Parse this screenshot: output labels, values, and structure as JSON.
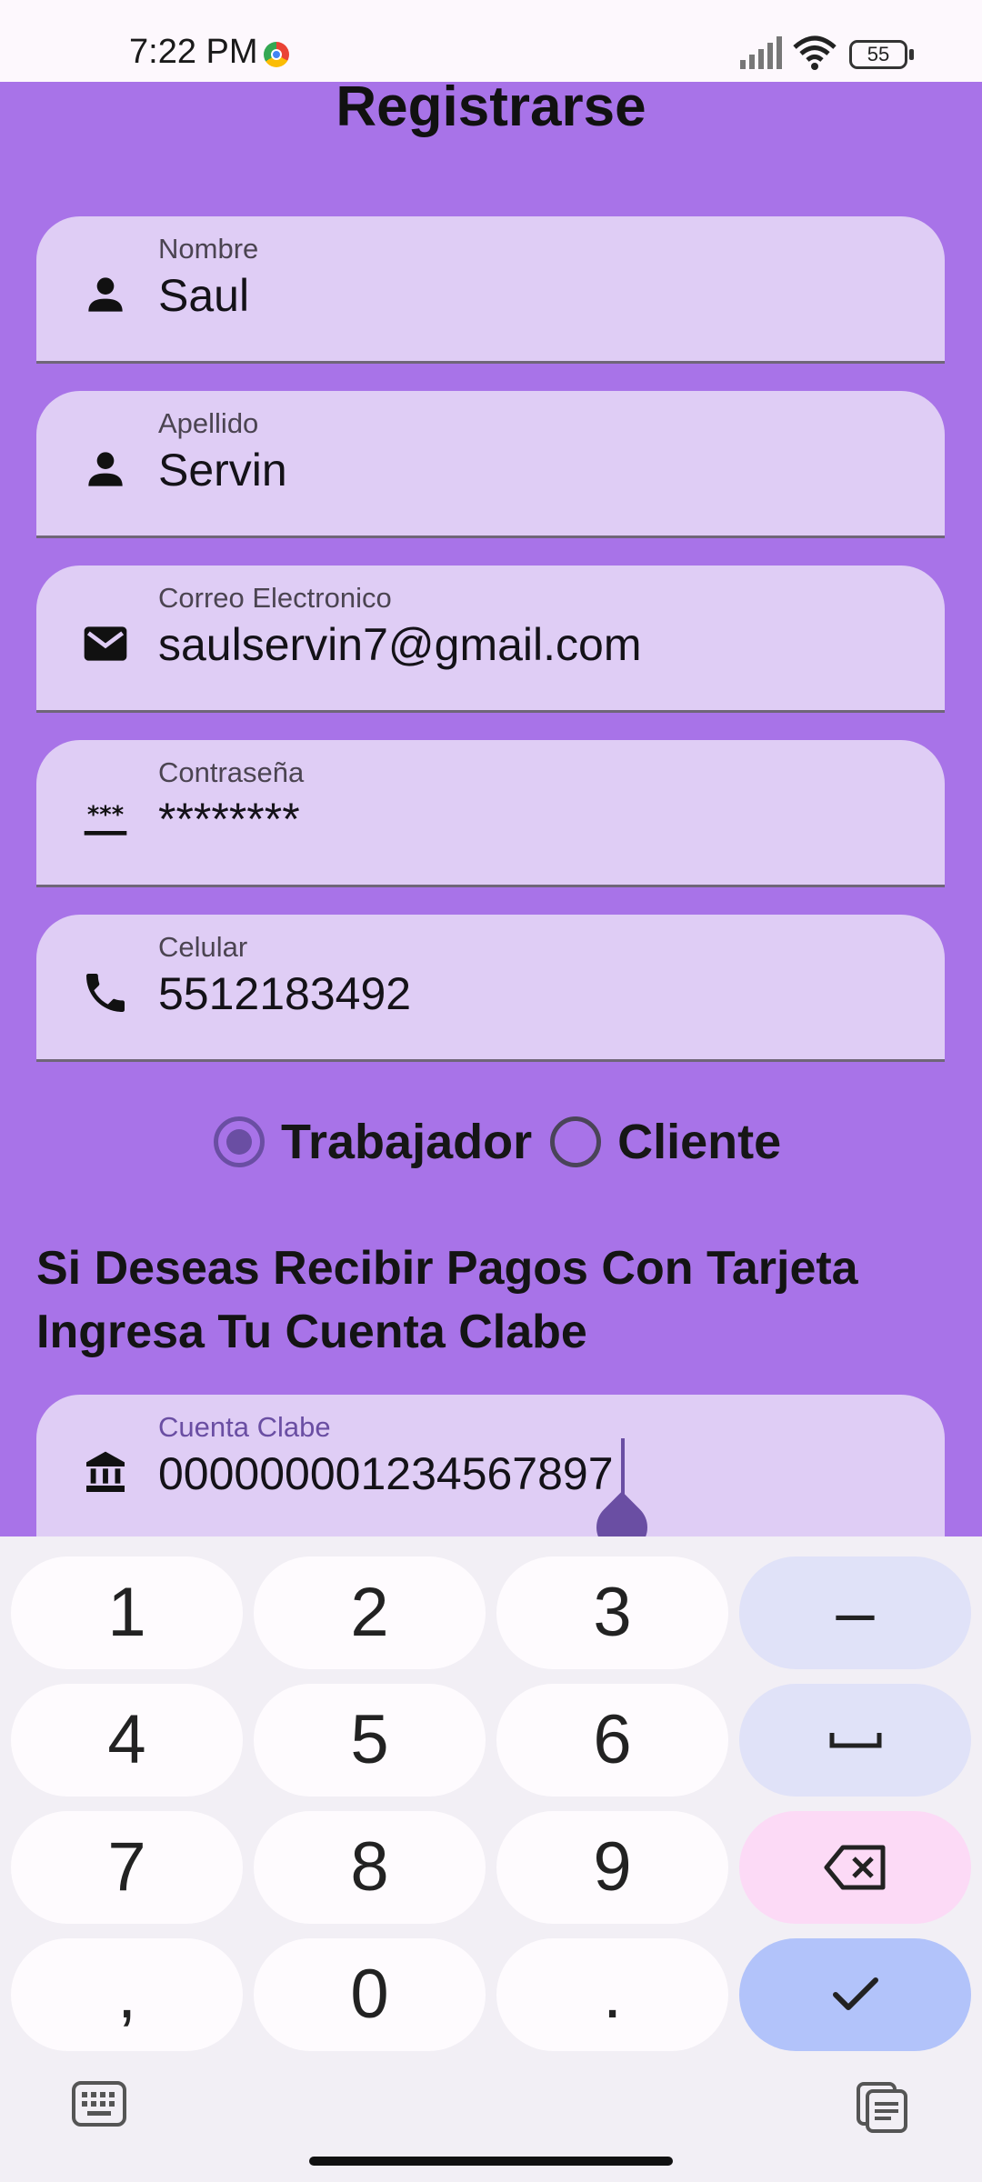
{
  "status_bar": {
    "time": "7:22 PM",
    "battery": "55",
    "icons": [
      "chrome-icon",
      "signal-icon",
      "wifi-icon",
      "battery-icon"
    ]
  },
  "page": {
    "title": "Registrarse",
    "background_color": "#a873e8",
    "field_color": "#dfcdf5",
    "accent_color": "#6a4ea3"
  },
  "fields": [
    {
      "label": "Nombre",
      "value": "Saul",
      "icon": "person-icon"
    },
    {
      "label": "Apellido",
      "value": "Servin",
      "icon": "person-icon"
    },
    {
      "label": "Correo Electronico",
      "value": "saulservin7@gmail.com",
      "icon": "mail-icon"
    },
    {
      "label": "Contraseña",
      "value": "********",
      "icon": "password-icon"
    },
    {
      "label": "Celular",
      "value": "5512183492",
      "icon": "phone-icon"
    }
  ],
  "role": {
    "options": [
      "Trabajador",
      "Cliente"
    ],
    "selected": "Trabajador"
  },
  "info_text": "Si Deseas Recibir Pagos Con Tarjeta Ingresa Tu Cuenta Clabe",
  "clabe_field": {
    "label": "Cuenta Clabe",
    "value": "000000001234567897",
    "icon": "bank-icon"
  },
  "keyboard": {
    "keys": [
      "1",
      "2",
      "3",
      "4",
      "5",
      "6",
      "7",
      "8",
      "9",
      ",",
      "0",
      "."
    ],
    "function_keys": [
      "–"
    ],
    "icons": [
      "space-icon",
      "backspace-icon",
      "check-icon",
      "keyboard-switch-icon",
      "clipboard-icon"
    ]
  }
}
